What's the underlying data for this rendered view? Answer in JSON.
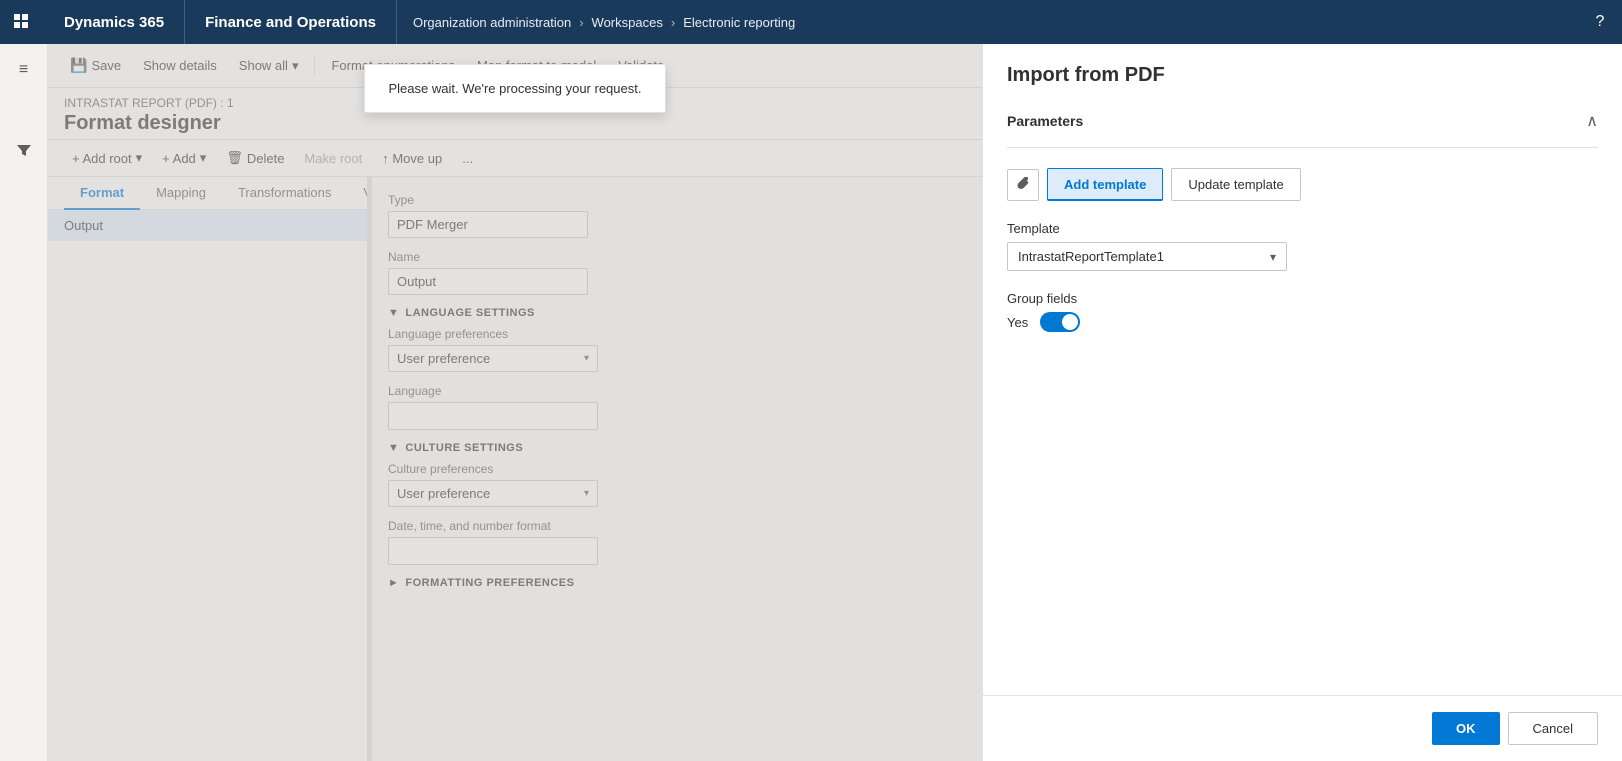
{
  "topnav": {
    "apps_icon": "⊞",
    "dynamics_label": "Dynamics 365",
    "finance_label": "Finance and Operations",
    "breadcrumb": [
      "Organization administration",
      "Workspaces",
      "Electronic reporting"
    ],
    "help_icon": "?"
  },
  "sidebar": {
    "menu_icon": "≡",
    "filter_icon": "▽"
  },
  "toolbar": {
    "save_label": "Save",
    "show_details_label": "Show details",
    "show_all_label": "Show all",
    "format_enumerations_label": "Format enumerations",
    "map_format_label": "Map format to model",
    "validate_label": "Validate"
  },
  "page": {
    "breadcrumb": "INTRASTAT REPORT (PDF) : 1",
    "title": "Format designer"
  },
  "format_toolbar": {
    "add_root_label": "+ Add root",
    "add_label": "+ Add",
    "delete_label": "Delete",
    "make_root_label": "Make root",
    "move_up_label": "↑ Move up",
    "more_label": "..."
  },
  "tabs": {
    "items": [
      "Format",
      "Mapping",
      "Transformations",
      "V"
    ]
  },
  "tree": {
    "items": [
      "Output"
    ]
  },
  "properties": {
    "type_label": "Type",
    "type_value": "PDF Merger",
    "name_label": "Name",
    "name_value": "Output",
    "language_settings_label": "LANGUAGE SETTINGS",
    "language_pref_label": "Language preferences",
    "language_pref_value": "User preference",
    "language_label": "Language",
    "culture_settings_label": "CULTURE SETTINGS",
    "culture_pref_label": "Culture preferences",
    "culture_pref_value": "User preference",
    "date_format_label": "Date, time, and number format",
    "formatting_prefs_label": "FORMATTING PREFERENCES"
  },
  "toast": {
    "message": "Please wait. We're processing your request."
  },
  "right_panel": {
    "title": "Import from PDF",
    "params_label": "Parameters",
    "collapse_icon": "∧",
    "attach_icon": "📎",
    "add_template_label": "Add template",
    "update_template_label": "Update template",
    "template_label": "Template",
    "template_value": "IntrastatReportTemplate1",
    "group_fields_label": "Group fields",
    "toggle_yes_label": "Yes",
    "ok_label": "OK",
    "cancel_label": "Cancel"
  }
}
